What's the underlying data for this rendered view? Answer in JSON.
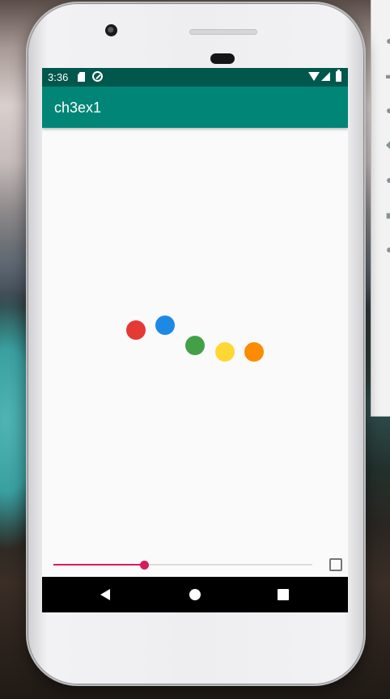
{
  "status_bar": {
    "time": "3:36",
    "icons": [
      "sd-card-icon",
      "sync-icon",
      "wifi-icon",
      "signal-icon",
      "battery-icon"
    ],
    "color": "#00574b"
  },
  "app_bar": {
    "title": "ch3ex1",
    "color": "#008577"
  },
  "dots": [
    {
      "name": "red-dot",
      "color": "#e53935"
    },
    {
      "name": "blue-dot",
      "color": "#1e88e5"
    },
    {
      "name": "green-dot",
      "color": "#43a047"
    },
    {
      "name": "yellow-dot",
      "color": "#fdd835"
    },
    {
      "name": "orange-dot",
      "color": "#fb8c00"
    }
  ],
  "seekbar": {
    "value": 0.35,
    "accent": "#d81b60"
  },
  "checkbox": {
    "checked": false
  },
  "navigation": {
    "buttons": [
      "back-icon",
      "home-icon",
      "recents-icon"
    ]
  }
}
